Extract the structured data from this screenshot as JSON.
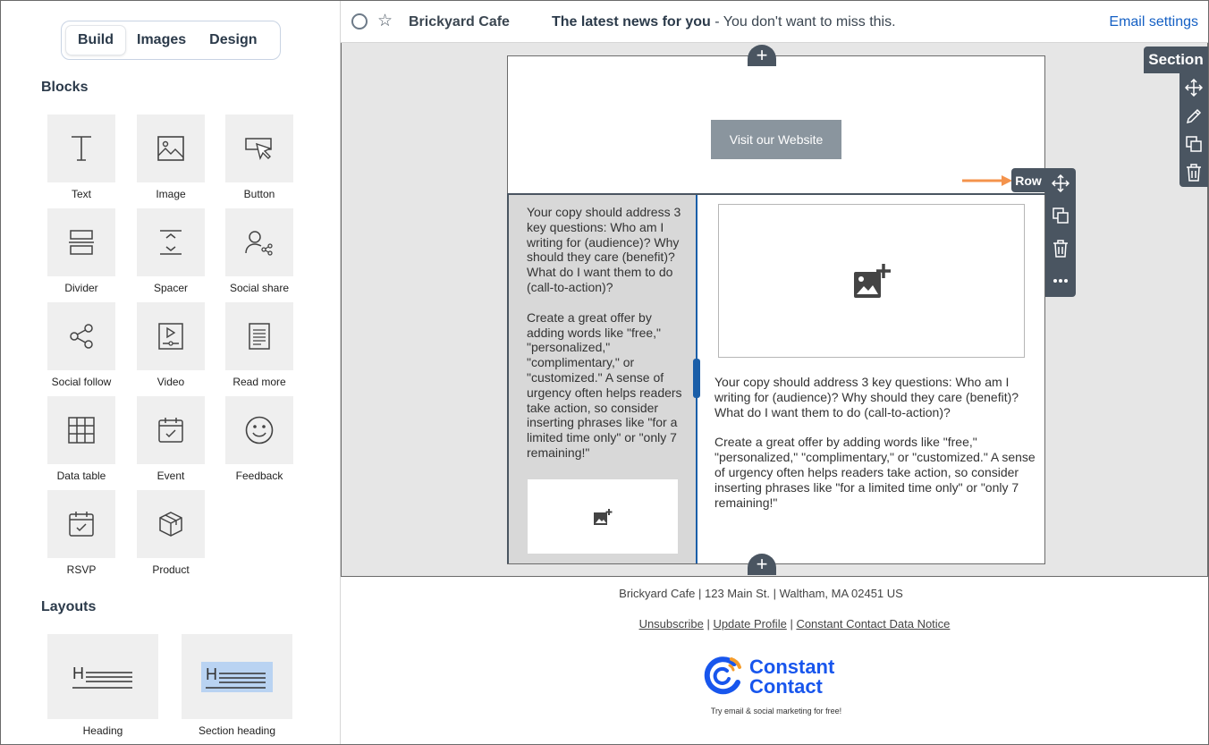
{
  "sidebar": {
    "tabs": [
      {
        "label": "Build",
        "active": true
      },
      {
        "label": "Images",
        "active": false
      },
      {
        "label": "Design",
        "active": false
      }
    ],
    "blocks_heading": "Blocks",
    "blocks": [
      {
        "label": "Text",
        "icon": "text-icon"
      },
      {
        "label": "Image",
        "icon": "image-icon"
      },
      {
        "label": "Button",
        "icon": "button-icon"
      },
      {
        "label": "Divider",
        "icon": "divider-icon"
      },
      {
        "label": "Spacer",
        "icon": "spacer-icon"
      },
      {
        "label": "Social share",
        "icon": "social-share-icon"
      },
      {
        "label": "Social follow",
        "icon": "social-follow-icon"
      },
      {
        "label": "Video",
        "icon": "video-icon"
      },
      {
        "label": "Read more",
        "icon": "read-more-icon"
      },
      {
        "label": "Data table",
        "icon": "data-table-icon"
      },
      {
        "label": "Event",
        "icon": "event-icon"
      },
      {
        "label": "Feedback",
        "icon": "feedback-icon"
      },
      {
        "label": "RSVP",
        "icon": "rsvp-icon"
      },
      {
        "label": "Product",
        "icon": "product-icon"
      }
    ],
    "layouts_heading": "Layouts",
    "layouts": [
      {
        "label": "Heading",
        "icon": "heading-layout-icon"
      },
      {
        "label": "Section heading",
        "icon": "section-heading-layout-icon"
      }
    ]
  },
  "header": {
    "sender": "Brickyard Cafe",
    "subject_bold": "The latest news for you",
    "subject_rest": " - You don't want to miss this.",
    "email_settings": "Email settings"
  },
  "email": {
    "visit_button": "Visit our Website",
    "left_copy_p1": "Your copy should address 3 key questions: Who am I writing for (audience)? Why should they care (benefit)? What do I want them to do (call-to-action)?",
    "left_copy_p2": "Create a great offer by adding words like \"free,\" \"personalized,\" \"complimentary,\" or \"customized.\" A sense of urgency often helps readers take action, so consider inserting phrases like \"for a limited time only\" or \"only 7 remaining!\"",
    "right_copy_p1": "Your copy should address 3 key questions: Who am I writing for (audience)? Why should they care (benefit)? What do I want them to do (call-to-action)?",
    "right_copy_p2": "Create a great offer by adding words like \"free,\" \"personalized,\" \"complimentary,\" or \"customized.\" A sense of urgency often helps readers take action, so consider inserting phrases like \"for a limited time only\" or \"only 7 remaining!\""
  },
  "toolbars": {
    "section_label": "Section",
    "row_label": "Row",
    "add_symbol": "+"
  },
  "footer": {
    "address": "Brickyard Cafe | 123 Main St. | Waltham, MA 02451 US",
    "links": [
      "Unsubscribe",
      "Update Profile",
      "Constant Contact Data Notice"
    ],
    "separator": " | ",
    "logo_line1": "Constant",
    "logo_line2": "Contact",
    "tagline": "Try email & social marketing for free!"
  },
  "colors": {
    "accent": "#1560c4",
    "toolbar": "#4a5561",
    "arrow": "#f4934c",
    "logo_blue": "#1856ed"
  }
}
